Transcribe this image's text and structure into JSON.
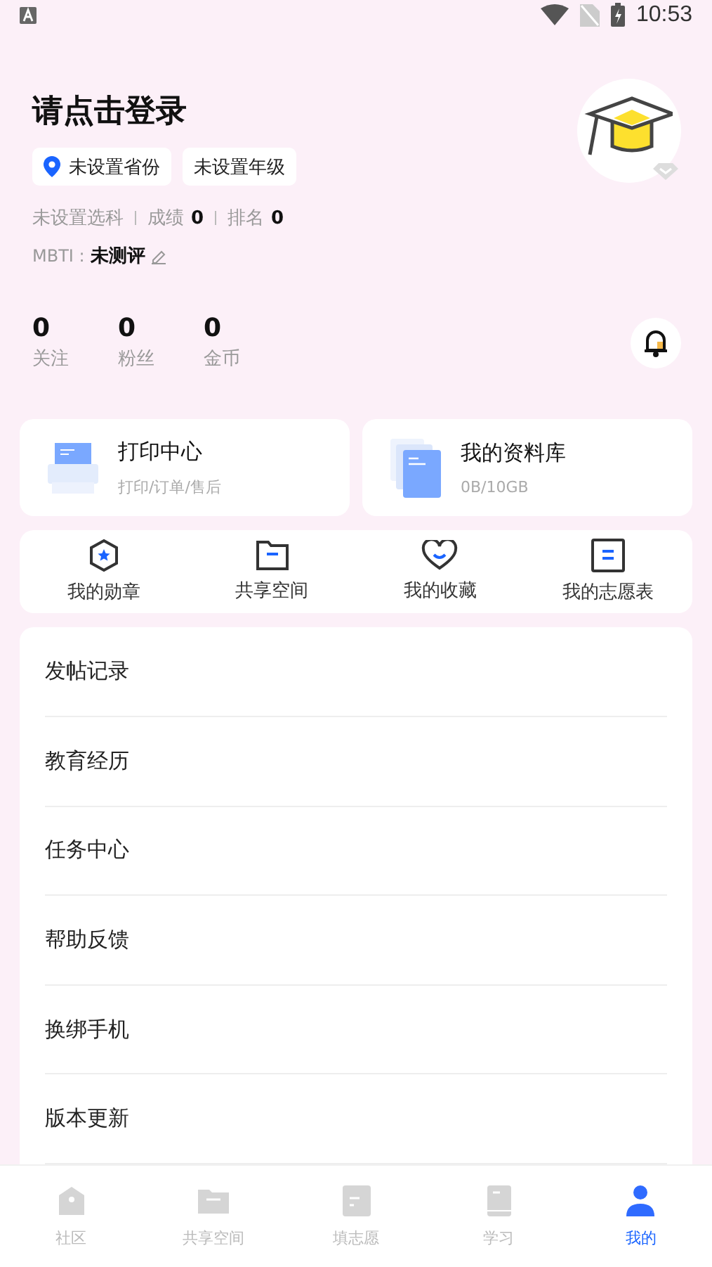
{
  "status_bar": {
    "time": "10:53"
  },
  "profile": {
    "title": "请点击登录",
    "tags": [
      {
        "text": "未设置省份",
        "kind": "location"
      },
      {
        "text": "未设置年级",
        "kind": "plain"
      }
    ],
    "info": [
      {
        "label": "未设置选科"
      },
      {
        "label": "成绩",
        "value": "0"
      },
      {
        "label": "排名",
        "value": "0"
      }
    ],
    "mbti": {
      "label": "MBTI :",
      "value": "未测评"
    },
    "stats": [
      {
        "value": "0",
        "label": "关注"
      },
      {
        "value": "0",
        "label": "粉丝"
      },
      {
        "value": "0",
        "label": "金币"
      }
    ]
  },
  "cards": [
    {
      "kind": "print",
      "title": "打印中心",
      "subtitle": "打印/订单/售后"
    },
    {
      "kind": "library",
      "title": "我的资料库",
      "subtitle": "0B/10GB"
    }
  ],
  "shortcuts": [
    {
      "kind": "badge",
      "label": "我的勋章"
    },
    {
      "kind": "folder",
      "label": "共享空间"
    },
    {
      "kind": "heart",
      "label": "我的收藏"
    },
    {
      "kind": "list",
      "label": "我的志愿表"
    }
  ],
  "menu": [
    "发帖记录",
    "教育经历",
    "任务中心",
    "帮助反馈",
    "换绑手机",
    "版本更新"
  ],
  "tabs": [
    {
      "kind": "home",
      "label": "社区",
      "selected": false
    },
    {
      "kind": "folder",
      "label": "共享空间",
      "selected": false
    },
    {
      "kind": "form",
      "label": "填志愿",
      "selected": false
    },
    {
      "kind": "book",
      "label": "学习",
      "selected": false
    },
    {
      "kind": "user",
      "label": "我的",
      "selected": true
    }
  ]
}
